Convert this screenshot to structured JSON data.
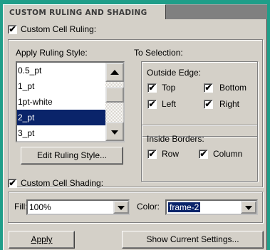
{
  "title": "CUSTOM RULING AND SHADING",
  "ruling": {
    "custom_label": "Custom Cell Ruling:",
    "custom_checked": true,
    "apply_style_label": "Apply Ruling Style:",
    "styles": [
      "0.5_pt",
      "1_pt",
      "1pt-white",
      "2_pt",
      "3_pt"
    ],
    "selected_style": "2_pt",
    "edit_button": "Edit Ruling Style..."
  },
  "selection": {
    "label": "To Selection:",
    "outside_edge": {
      "label": "Outside Edge:",
      "top": {
        "label": "Top",
        "checked": true
      },
      "bottom": {
        "label": "Bottom",
        "checked": true
      },
      "left": {
        "label": "Left",
        "checked": true
      },
      "right": {
        "label": "Right",
        "checked": true
      }
    },
    "inside_borders": {
      "label": "Inside Borders:",
      "row": {
        "label": "Row",
        "checked": true
      },
      "column": {
        "label": "Column",
        "checked": true
      }
    }
  },
  "shading": {
    "custom_label": "Custom Cell Shading:",
    "custom_checked": true,
    "fill_label": "Fill:",
    "fill_value": "100%",
    "color_label": "Color:",
    "color_value": "frame-2"
  },
  "footer": {
    "apply": "Apply",
    "show_current": "Show Current Settings..."
  },
  "check_glyph": "✔",
  "colors": {
    "accent_teal": "#1f9e89",
    "selection": "#0a246a",
    "face": "#d4d0c8"
  }
}
